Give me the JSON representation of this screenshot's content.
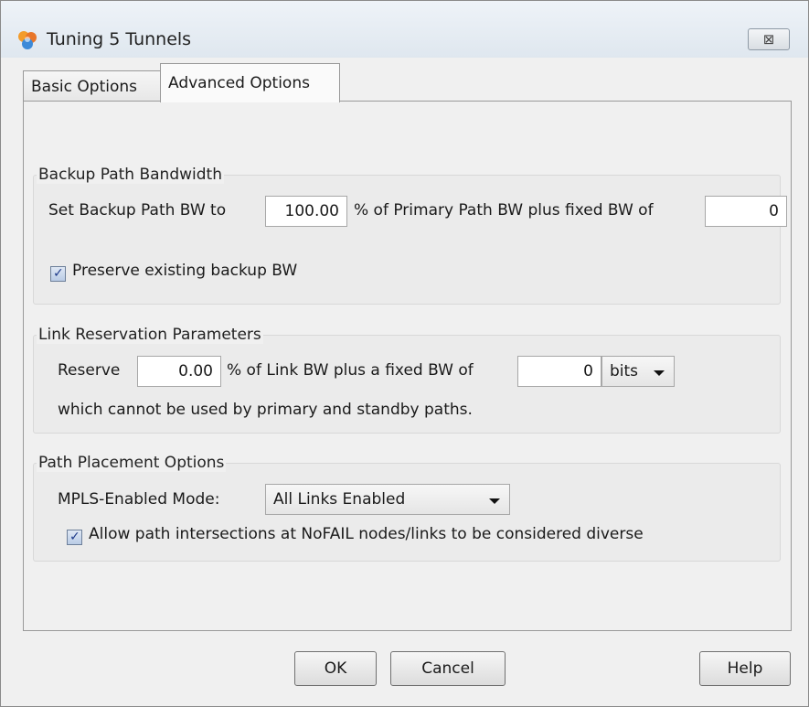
{
  "window": {
    "title": "Tuning 5 Tunnels",
    "close_symbol": "⊠"
  },
  "tabs": [
    {
      "label": "Basic Options"
    },
    {
      "label": "Advanced Options",
      "active": true
    }
  ],
  "backup": {
    "title": "Backup Path Bandwidth",
    "set_label": "Set Backup Path BW to",
    "percent_value": "100.00",
    "mid_label": "% of Primary Path BW plus fixed BW of",
    "fixed_value": "0",
    "preserve_label": "Preserve existing backup BW",
    "preserve_checked": true
  },
  "reservation": {
    "title": "Link Reservation Parameters",
    "reserve_label": "Reserve",
    "percent_value": "0.00",
    "mid_label": "% of Link BW plus a fixed BW of",
    "fixed_value": "0",
    "unit": "bits",
    "note": "which cannot be used by primary and standby paths."
  },
  "placement": {
    "title": "Path Placement Options",
    "mode_label": "MPLS-Enabled Mode:",
    "mode_value": "All Links Enabled",
    "allow_label": "Allow path intersections at NoFAIL nodes/links to be considered diverse",
    "allow_checked": true
  },
  "buttons": {
    "ok": "OK",
    "cancel": "Cancel",
    "help": "Help"
  },
  "colors": {
    "titlebar": "#dfe7ef",
    "check": "#1f3b8a"
  }
}
